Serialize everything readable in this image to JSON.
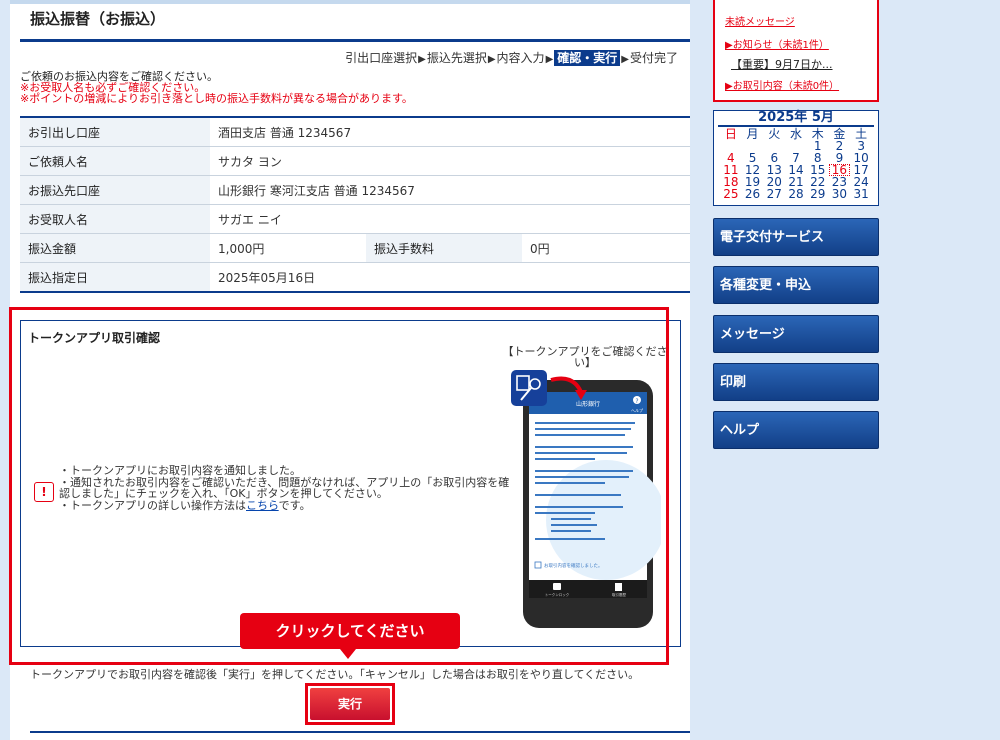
{
  "page": {
    "title": "振込振替（お振込）",
    "steps": [
      "引出口座選択",
      "振込先選択",
      "内容入力",
      "確認・実行",
      "受付完了"
    ],
    "notice_lines": [
      "ご依頼のお振込内容をご確認ください。",
      "※お受取人名も必ずご確認ください。",
      "※ポイントの増減によりお引き落とし時の振込手数料が異なる場合があります。"
    ]
  },
  "details": {
    "withdrawal_label": "お引出し口座",
    "withdrawal_value": "酒田支店 普通 1234567",
    "requester_label": "ご依頼人名",
    "requester_value": "サカタ ヨン",
    "dest_label": "お振込先口座",
    "dest_value": "山形銀行 寒河江支店 普通 1234567",
    "recipient_label": "お受取人名",
    "recipient_value": "サガエ ニイ",
    "amount_label": "振込金額",
    "amount_value": "1,000円",
    "fee_label": "振込手数料",
    "fee_value": "0円",
    "date_label": "振込指定日",
    "date_value": "2025年05月16日"
  },
  "token": {
    "title": "トークンアプリ取引確認",
    "caption": "【トークンアプリをご確認ください】",
    "line1": "・トークンアプリにお取引内容を通知しました。",
    "line2": "・通知されたお取引内容をご確認いただき、問題がなければ、アプリ上の「お取引内容を確認しました」にチェックを入れ、「OK」ボタンを押してください。",
    "line3_prefix": "・トークンアプリの詳しい操作方法は",
    "line3_link": "こちら",
    "line3_suffix": "です。"
  },
  "phone": {
    "app_title": "山形銀行",
    "help_label": "ヘルプ",
    "checkbox_label": "お取引内容を確認しました。",
    "tab_left": "トークンロック",
    "tab_right": "取引履歴"
  },
  "instruction": "トークンアプリでお取引内容を確認後「実行」を押してください。「キャンセル」した場合はお取引をやり直してください。",
  "callout": "クリックしてください",
  "execute_label": "実行",
  "sidebar": {
    "unread_messages": "未読メッセージ",
    "notices": "▶お知らせ（未読1件）",
    "important": "【重要】9月7日か...",
    "transaction_notices": "▶お取引内容（未読0件）",
    "calendar_title": "2025年 5月",
    "weekdays": [
      "日",
      "月",
      "火",
      "水",
      "木",
      "金",
      "土"
    ],
    "today": "16",
    "nav": [
      "電子交付サービス",
      "各種変更・申込",
      "メッセージ",
      "印刷",
      "ヘルプ"
    ]
  },
  "colors": {
    "navy": "#0b3b8c",
    "accent_red": "#e60012",
    "page_bg": "#dbe8f7"
  }
}
